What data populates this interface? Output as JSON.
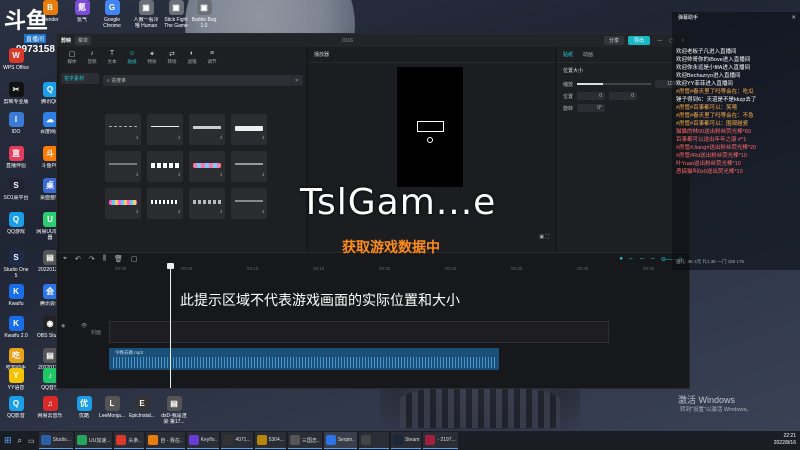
{
  "stream": {
    "platform": "斗鱼",
    "platform_sub": "直播间",
    "room_id": "9973158",
    "overlay_title": "TslGam...e",
    "status_text": "获取游戏数据中",
    "hint_text": "此提示区域不代表游戏画面的实际位置和大小"
  },
  "desktop_icons": [
    {
      "label": "WPS Office",
      "color": "#d9382b",
      "glyph": "W"
    },
    {
      "label": "Blender",
      "color": "#e87d0d",
      "glyph": "B"
    },
    {
      "label": "氪气",
      "color": "#7b4cd4",
      "glyph": "氪"
    },
    {
      "label": "Google Chrome",
      "color": "#4285f4",
      "glyph": "G"
    },
    {
      "label": "人傲一看冷哦 Human Fa...",
      "color": "#6c6f78",
      "glyph": "▣"
    },
    {
      "label": "Stick Fight The Game",
      "color": "#6c6f78",
      "glyph": "▣"
    },
    {
      "label": "Barbie Bug 1.0",
      "color": "#6c6f78",
      "glyph": "▣"
    },
    {
      "label": "剪映专业版",
      "color": "#111",
      "glyph": "✂"
    },
    {
      "label": "腾讯QQ",
      "color": "#1a9ee8",
      "glyph": "Q"
    },
    {
      "label": "IDO",
      "color": "#3a7bd5",
      "glyph": "I"
    },
    {
      "label": "百度网盘",
      "color": "#2f7fe8",
      "glyph": "☁"
    },
    {
      "label": "直播伴侣",
      "color": "#e83a5a",
      "glyph": "直"
    },
    {
      "label": "斗鱼PC",
      "color": "#ff7a00",
      "glyph": "斗"
    },
    {
      "label": "SO1桌平台",
      "color": "#223",
      "glyph": "S"
    },
    {
      "label": "桌面整理",
      "color": "#3a6ad4",
      "glyph": "桌"
    },
    {
      "label": "QQ游戏",
      "color": "#1a9ee8",
      "glyph": "Q"
    },
    {
      "label": "网易UU加速器",
      "color": "#2ecc71",
      "glyph": "U"
    },
    {
      "label": "Studio One 5",
      "color": "#1d2b4a",
      "glyph": "S"
    },
    {
      "label": "2022012...",
      "color": "#555",
      "glyph": "▤"
    },
    {
      "label": "Kwaifu",
      "color": "#1a6de8",
      "glyph": "K"
    },
    {
      "label": "腾讯会议",
      "color": "#2b75e8",
      "glyph": "会"
    },
    {
      "label": "Kwaifu 2.0",
      "color": "#1a6de8",
      "glyph": "K"
    },
    {
      "label": "OBS Studio",
      "color": "#222",
      "glyph": "◉"
    },
    {
      "label": "吃鸡助手",
      "color": "#e8a21a",
      "glyph": "吃"
    },
    {
      "label": "2022012...",
      "color": "#555",
      "glyph": "▤"
    },
    {
      "label": "YY语音",
      "color": "#f5c400",
      "glyph": "Y"
    },
    {
      "label": "QQ音乐",
      "color": "#1ec864",
      "glyph": "♪"
    },
    {
      "label": "QQ影音",
      "color": "#1a9ee8",
      "glyph": "Q"
    },
    {
      "label": "网易云音乐",
      "color": "#d82a2a",
      "glyph": "♫"
    },
    {
      "label": "优酷",
      "color": "#1a9ee8",
      "glyph": "优"
    },
    {
      "label": "LeeMonja...",
      "color": "#555",
      "glyph": "L"
    },
    {
      "label": "EpicInstal...",
      "color": "#333",
      "glyph": "E"
    },
    {
      "label": "dsD-我是渲染 第17...",
      "color": "#555",
      "glyph": "▤"
    }
  ],
  "editor": {
    "app_name": "剪映",
    "menu_label": "菜单",
    "project_title": "0316",
    "share_label": "分享",
    "export_label": "导出",
    "tools": [
      {
        "label": "媒体",
        "icon": "▢"
      },
      {
        "label": "音频",
        "icon": "♪"
      },
      {
        "label": "文本",
        "icon": "T"
      },
      {
        "label": "贴纸",
        "icon": "☺"
      },
      {
        "label": "特效",
        "icon": "✦"
      },
      {
        "label": "转场",
        "icon": "⇄"
      },
      {
        "label": "滤镜",
        "icon": "◐"
      },
      {
        "label": "调节",
        "icon": "≡"
      }
    ],
    "active_tool": 3,
    "category": "花字素材",
    "search_value": "进度条",
    "preview_title": "播放器",
    "props_tabs": [
      "贴纸",
      "动画"
    ],
    "props_section": "位置大小",
    "props_rows": [
      {
        "label": "缩放",
        "value": "100%"
      },
      {
        "label": "位置",
        "value": "0"
      },
      {
        "label": "旋转",
        "value": "0°"
      }
    ],
    "ruler_ticks": [
      "00:00",
      "00:05",
      "00:10",
      "00:15",
      "00:20",
      "00:25",
      "00:30",
      "00:35",
      "00:40"
    ],
    "audio_clip_name": "今晚去踢.mp3",
    "track_label": "封面"
  },
  "chat": {
    "title": "弹幕助手",
    "messages": [
      {
        "text": "欢迎老板子凡进入直播间",
        "color": "#ffffff"
      },
      {
        "text": "欢迎帅哥你的iBove进入直播间",
        "color": "#ffffff"
      },
      {
        "text": "欢迎你永远是小fifA进入直播间",
        "color": "#ffffff"
      },
      {
        "text": "欢迎Bechazryo进入直播间",
        "color": "#ffffff"
      },
      {
        "text": "欢迎YY菲菲进入直播间",
        "color": "#ffffff"
      },
      {
        "text": "#房管#春天里了吗等会在：吃瓜",
        "color": "#ffb04a"
      },
      {
        "text": "锤子得到6：天道是不是kkzp去了",
        "color": "#ffffff"
      },
      {
        "text": "#房管#百事都可以：笑嘻",
        "color": "#ffb04a"
      },
      {
        "text": "#房管#春天里了吗等会在：不急",
        "color": "#ffb04a"
      },
      {
        "text": "#房管#百事都可以：围观碰瓷",
        "color": "#ffb04a"
      },
      {
        "text": "猫猫的林00送出粉丝荧光棒*60",
        "color": "#ff6a6a"
      },
      {
        "text": "百事都可以送出年年之康 #*1",
        "color": "#ff6a6a"
      },
      {
        "text": "#房管#Jiang#送出粉丝荧光棒*20",
        "color": "#ff6a6a"
      },
      {
        "text": "#房管#Rd送出粉丝荧光棒*10",
        "color": "#ff6a6a"
      },
      {
        "text": "叶Yuan送出粉丝荧光棒*10",
        "color": "#ff6a6a"
      },
      {
        "text": "恶搞猫叫0x0送出荧光棒*10",
        "color": "#ff6a6a"
      }
    ],
    "stats": "送礼: 4K 4元 礼1.3K 一门 150 176"
  },
  "windows_mark": {
    "line1": "激活 Windows",
    "line2": "转到\"设置\"以激活 Windows。"
  },
  "taskbar": {
    "apps": [
      "Studio...",
      "UU加速...",
      "头条..",
      "自 - 我在..",
      "Keyflo..",
      "4071...",
      "5304...",
      "三国志..",
      "Serpin..",
      "",
      "Steam",
      "- 2197..."
    ],
    "time": "22:21",
    "date": "2022/8/16"
  }
}
